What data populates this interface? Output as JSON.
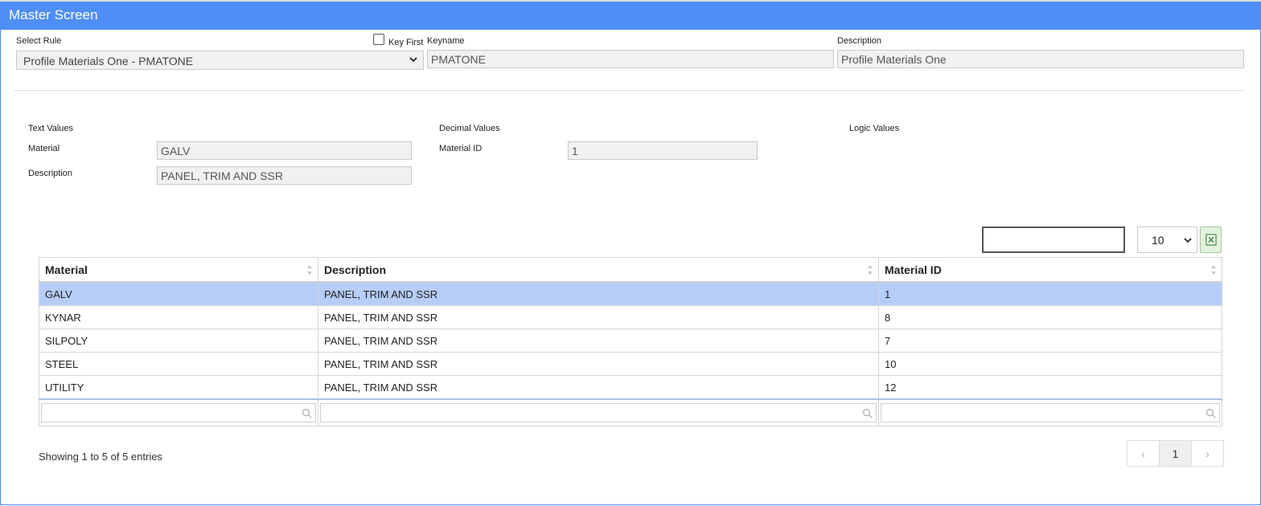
{
  "window": {
    "title": "Master Screen"
  },
  "header": {
    "select_rule_label": "Select Rule",
    "select_rule_value": "Profile Materials One - PMATONE",
    "key_first_label": "Key First",
    "keyname_label": "Keyname",
    "keyname_value": "PMATONE",
    "description_label": "Description",
    "description_value": "Profile Materials One"
  },
  "values": {
    "text_values_label": "Text Values",
    "decimal_values_label": "Decimal Values",
    "logic_values_label": "Logic Values",
    "material_label": "Material",
    "material_value": "GALV",
    "description_label": "Description",
    "description_value": "PANEL, TRIM AND SSR",
    "material_id_label": "Material ID",
    "material_id_value": "1"
  },
  "table_controls": {
    "page_size": "10"
  },
  "table": {
    "columns": [
      "Material",
      "Description",
      "Material ID"
    ],
    "rows": [
      [
        "GALV",
        "PANEL, TRIM AND SSR",
        "1"
      ],
      [
        "KYNAR",
        "PANEL, TRIM AND SSR",
        "8"
      ],
      [
        "SILPOLY",
        "PANEL, TRIM AND SSR",
        "7"
      ],
      [
        "STEEL",
        "PANEL, TRIM AND SSR",
        "10"
      ],
      [
        "UTILITY",
        "PANEL, TRIM AND SSR",
        "12"
      ]
    ],
    "selected_row": 0
  },
  "footer": {
    "info": "Showing 1 to 5 of 5 entries",
    "prev": "‹",
    "current_page": "1",
    "next": "›"
  },
  "colors": {
    "title_bar": "#4f8ef7",
    "selected_row": "#b6cdf7"
  }
}
